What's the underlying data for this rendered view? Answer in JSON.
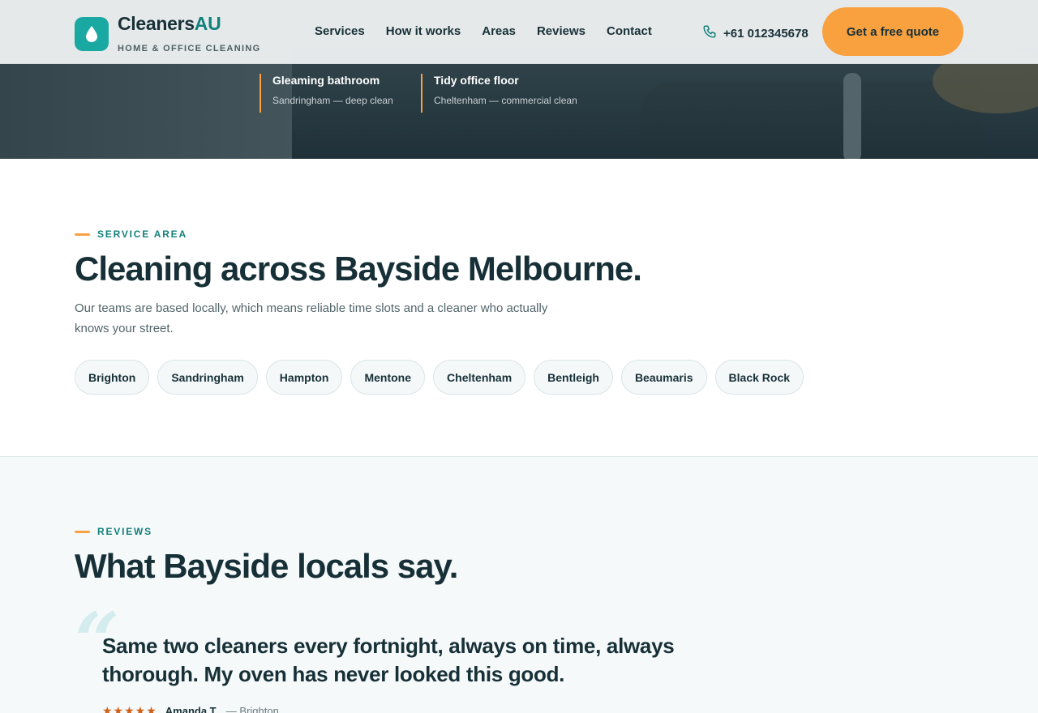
{
  "header": {
    "brand_name": "Cleaners",
    "brand_accent": "AU",
    "tagline": "HOME & OFFICE CLEANING",
    "nav": [
      "Services",
      "How it works",
      "Areas",
      "Reviews",
      "Contact"
    ],
    "phone": "+61 012345678",
    "cta_label": "Get a free quote"
  },
  "hero": {
    "captions": [
      {
        "title": "Gleaming bathroom",
        "subtitle": "Sandringham — deep clean"
      },
      {
        "title": "Tidy office floor",
        "subtitle": "Cheltenham — commercial clean"
      }
    ]
  },
  "service_area": {
    "eyebrow": "SERVICE AREA",
    "heading": "Cleaning across Bayside Melbourne.",
    "lead": "Our teams are based locally, which means reliable time slots and a cleaner who actually knows your street.",
    "suburbs": [
      "Brighton",
      "Sandringham",
      "Hampton",
      "Mentone",
      "Cheltenham",
      "Bentleigh",
      "Beaumaris",
      "Black Rock"
    ]
  },
  "reviews": {
    "eyebrow": "REVIEWS",
    "heading": "What Bayside locals say.",
    "quote": "Same two cleaners every fortnight, always on time, always thorough. My oven has never looked this good.",
    "stars": "★★★★★",
    "rating": 5,
    "reviewer": "Amanda T.",
    "location": "— Brighton"
  },
  "colors": {
    "primary": "#13807c",
    "logo_bg": "#1aa9a2",
    "cta": "#f9a03f",
    "text": "#173037",
    "star": "#d0611a"
  },
  "icons": {
    "logo": "water-drop-icon",
    "phone": "phone-icon"
  }
}
